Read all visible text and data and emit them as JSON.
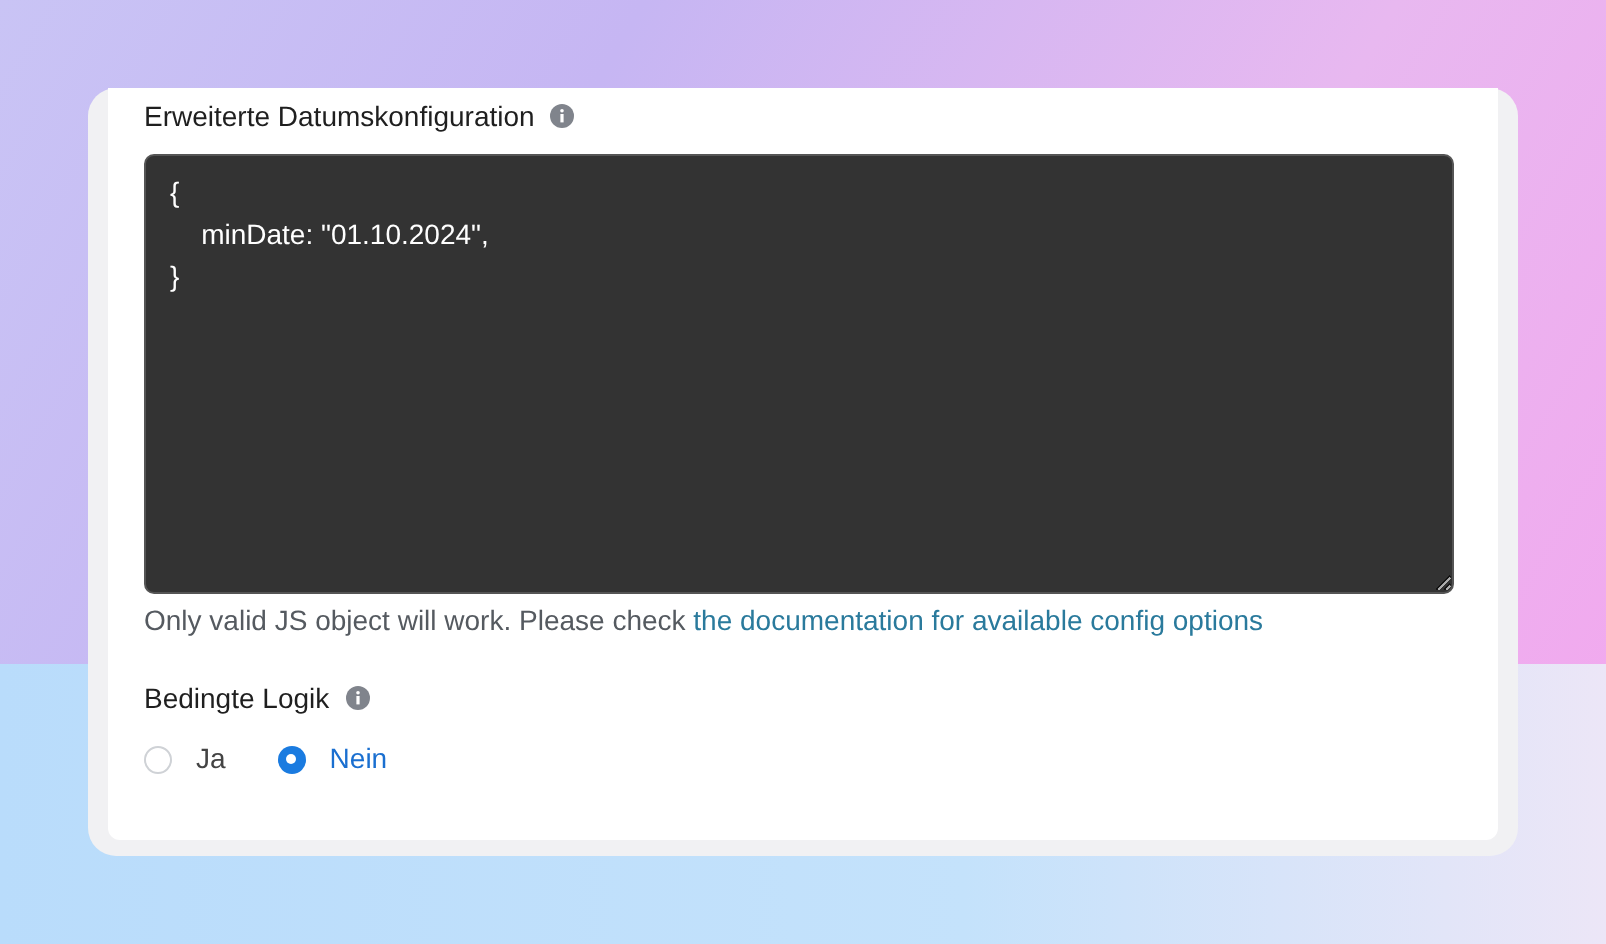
{
  "date_config": {
    "label": "Erweiterte Datumskonfiguration",
    "value": "{\n    minDate: \"01.10.2024\",\n}",
    "help_text": "Only valid JS object will work. Please check ",
    "help_link": "the documentation for available config options"
  },
  "conditional_logic": {
    "label": "Bedingte Logik",
    "options": [
      {
        "label": "Ja",
        "selected": false
      },
      {
        "label": "Nein",
        "selected": true
      }
    ]
  }
}
